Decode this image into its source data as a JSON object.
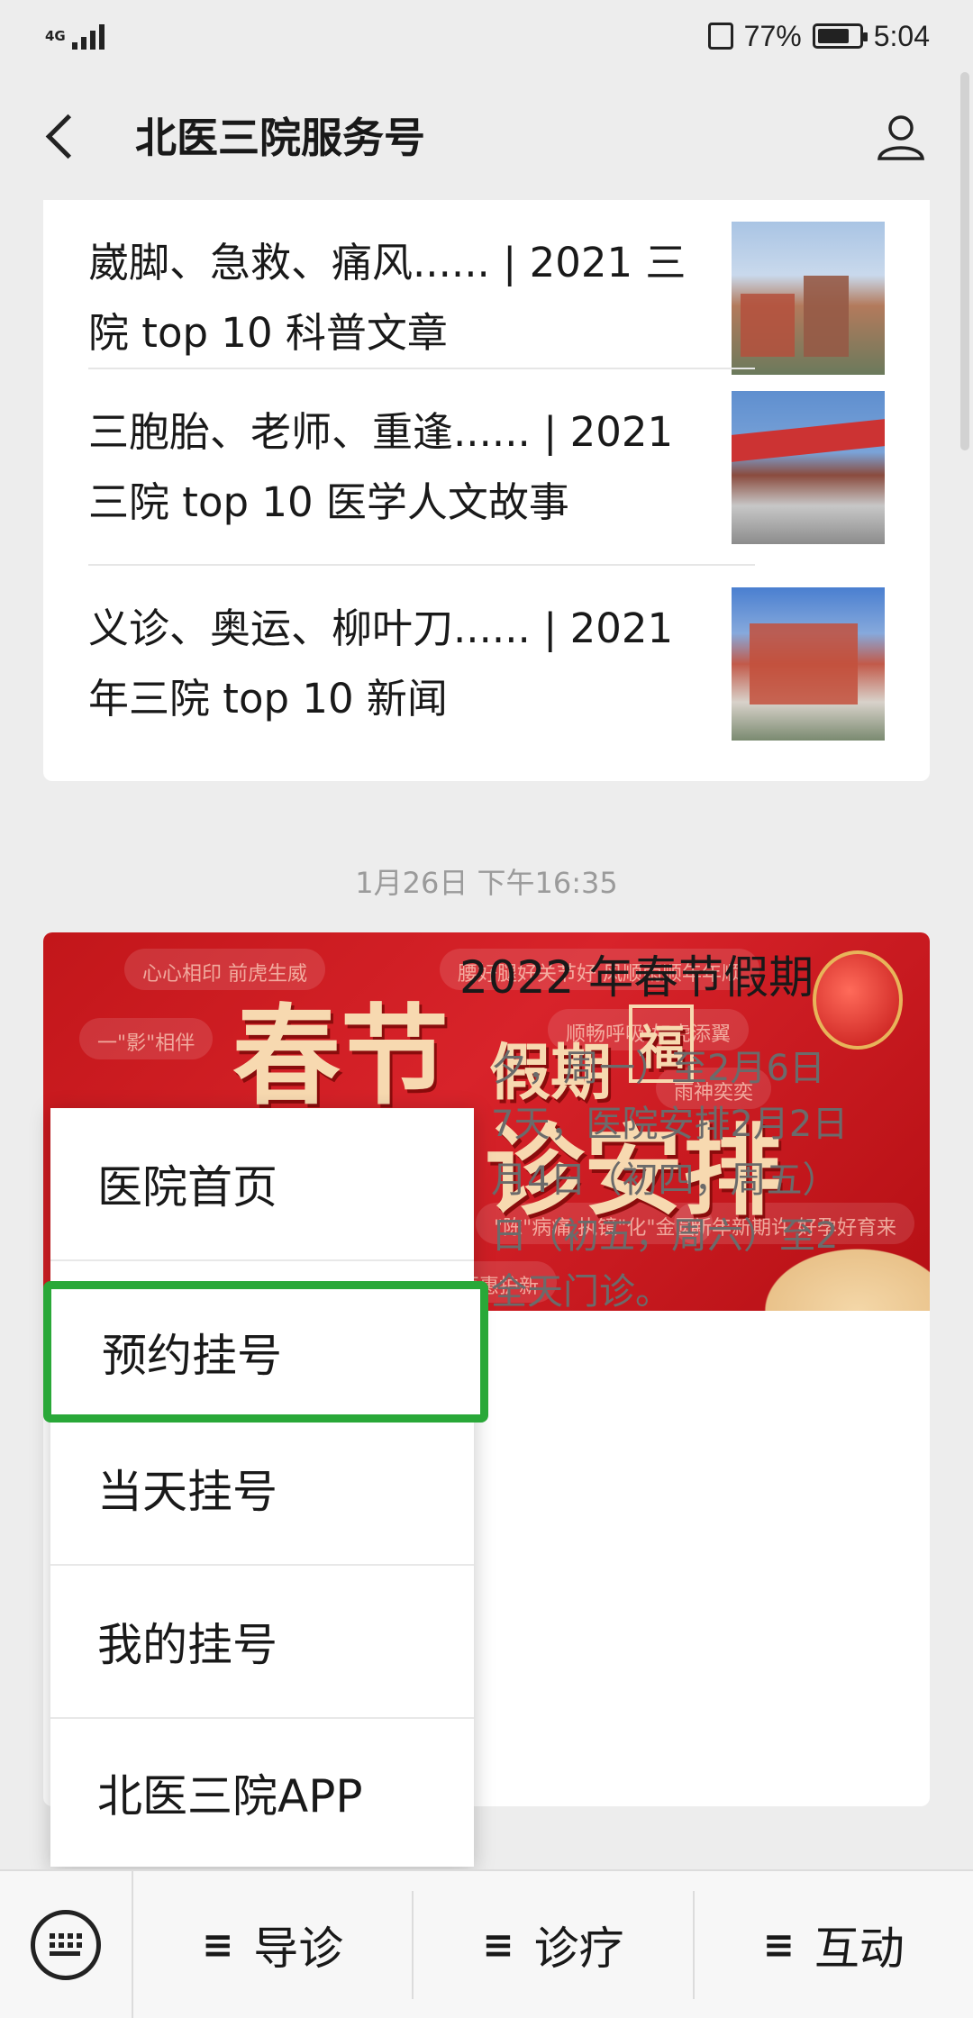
{
  "status_bar": {
    "network": "4G",
    "battery_percent": "77%",
    "battery_level": 0.77,
    "time": "5:04"
  },
  "nav": {
    "title": "北医三院服务号",
    "back_icon": "back-chevron-icon",
    "profile_icon": "person-icon"
  },
  "articles": [
    {
      "title": "崴脚、急救、痛风...... | 2021 三院 top 10 科普文章"
    },
    {
      "title": "三胞胎、老师、重逢...... | 2021 三院 top 10 医学人文故事"
    },
    {
      "title": "义诊、奥运、柳叶刀...... | 2021 年三院 top 10 新闻"
    }
  ],
  "timestamp": "1月26日 下午16:35",
  "card2": {
    "banner": {
      "big_line1": "春节",
      "small_line": "假期",
      "fu": "福",
      "big_line2": "诊安排",
      "pills": [
        "心心相印 前虎生威",
        "一\"影\"相伴",
        "腰好腿好关节好 风顺雨顺年年顺",
        "顺畅呼吸 如虎添翼",
        "雨神奕奕",
        "\"陈\"病痛 执镜\"化\"金圆",
        "新年新期许 好孕好育来",
        "话医惠护新"
      ]
    },
    "title_visible": "2022 年春节假期",
    "body_lines": [
      "夕，周一）至2月6日",
      "7天，医院安排2月2日",
      "月4日（初四，周五）",
      "日（初五，周六）至2",
      "全天门诊。"
    ]
  },
  "popup_menu": {
    "items": [
      "医院首页",
      "预约挂号",
      "当天挂号",
      "我的挂号",
      "北医三院APP"
    ],
    "highlighted_index": 1,
    "highlight_color": "#29a838"
  },
  "bottom_menu": {
    "keyboard_icon": "keyboard-icon",
    "glyph": "≡",
    "items": [
      "导诊",
      "诊疗",
      "互动"
    ]
  }
}
